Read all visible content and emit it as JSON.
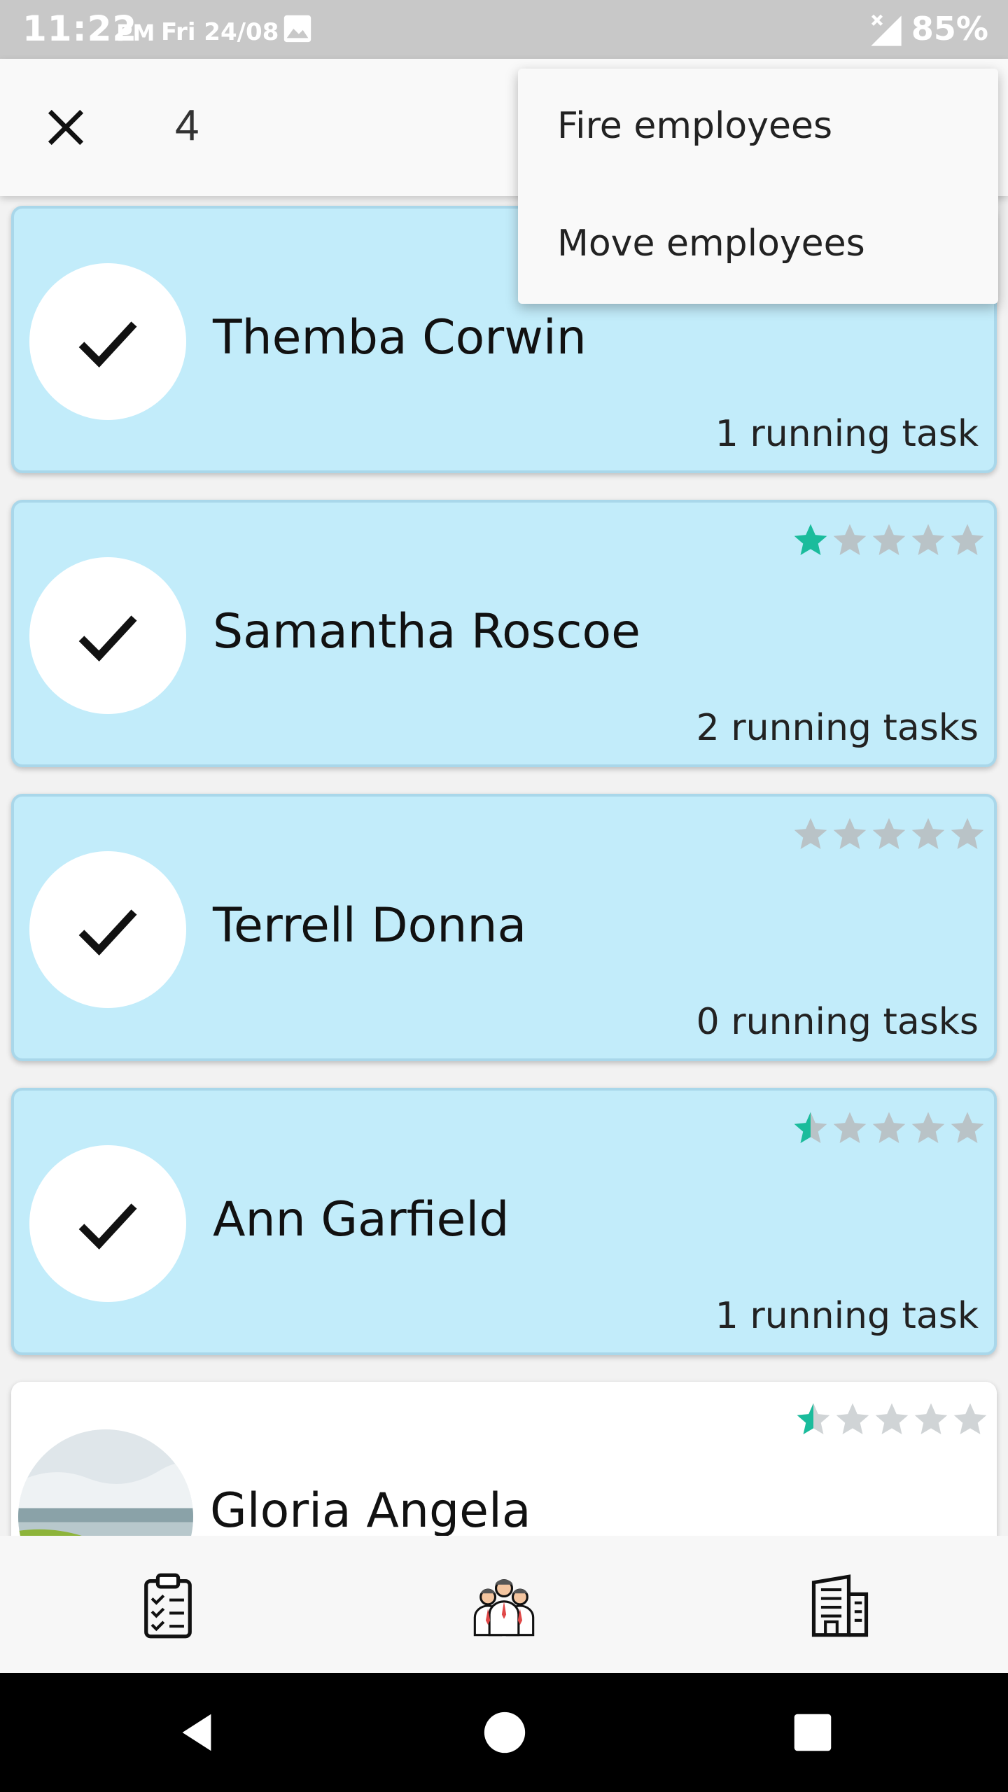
{
  "status_bar": {
    "time": "11:22",
    "ampm": "PM",
    "date": "Fri 24/08",
    "battery": "85%"
  },
  "app_bar": {
    "selected_count": "4"
  },
  "menu": {
    "items": [
      {
        "label": "Fire employees"
      },
      {
        "label": "Move employees"
      }
    ]
  },
  "employees": [
    {
      "name": "Themba Corwin",
      "tasks": "1 running task",
      "rating": null,
      "selected": true
    },
    {
      "name": "Samantha Roscoe",
      "tasks": "2 running tasks",
      "rating": 1,
      "selected": true
    },
    {
      "name": "Terrell Donna",
      "tasks": "0 running tasks",
      "rating": 0,
      "selected": true
    },
    {
      "name": "Ann Garfield",
      "tasks": "1 running task",
      "rating": 0.5,
      "selected": true
    },
    {
      "name": "Gloria Angela",
      "tasks": "",
      "rating": 0.5,
      "selected": false
    }
  ],
  "colors": {
    "selected_card": "#c2ecfa",
    "star_filled": "#1abc9c",
    "star_empty": "#b9c3c7",
    "status_bar": "#c8c8c8"
  },
  "icons": {
    "close": "close-icon",
    "check": "check-icon",
    "nav_tasks": "clipboard-icon",
    "nav_employees": "employees-group-icon",
    "nav_company": "building-icon"
  }
}
